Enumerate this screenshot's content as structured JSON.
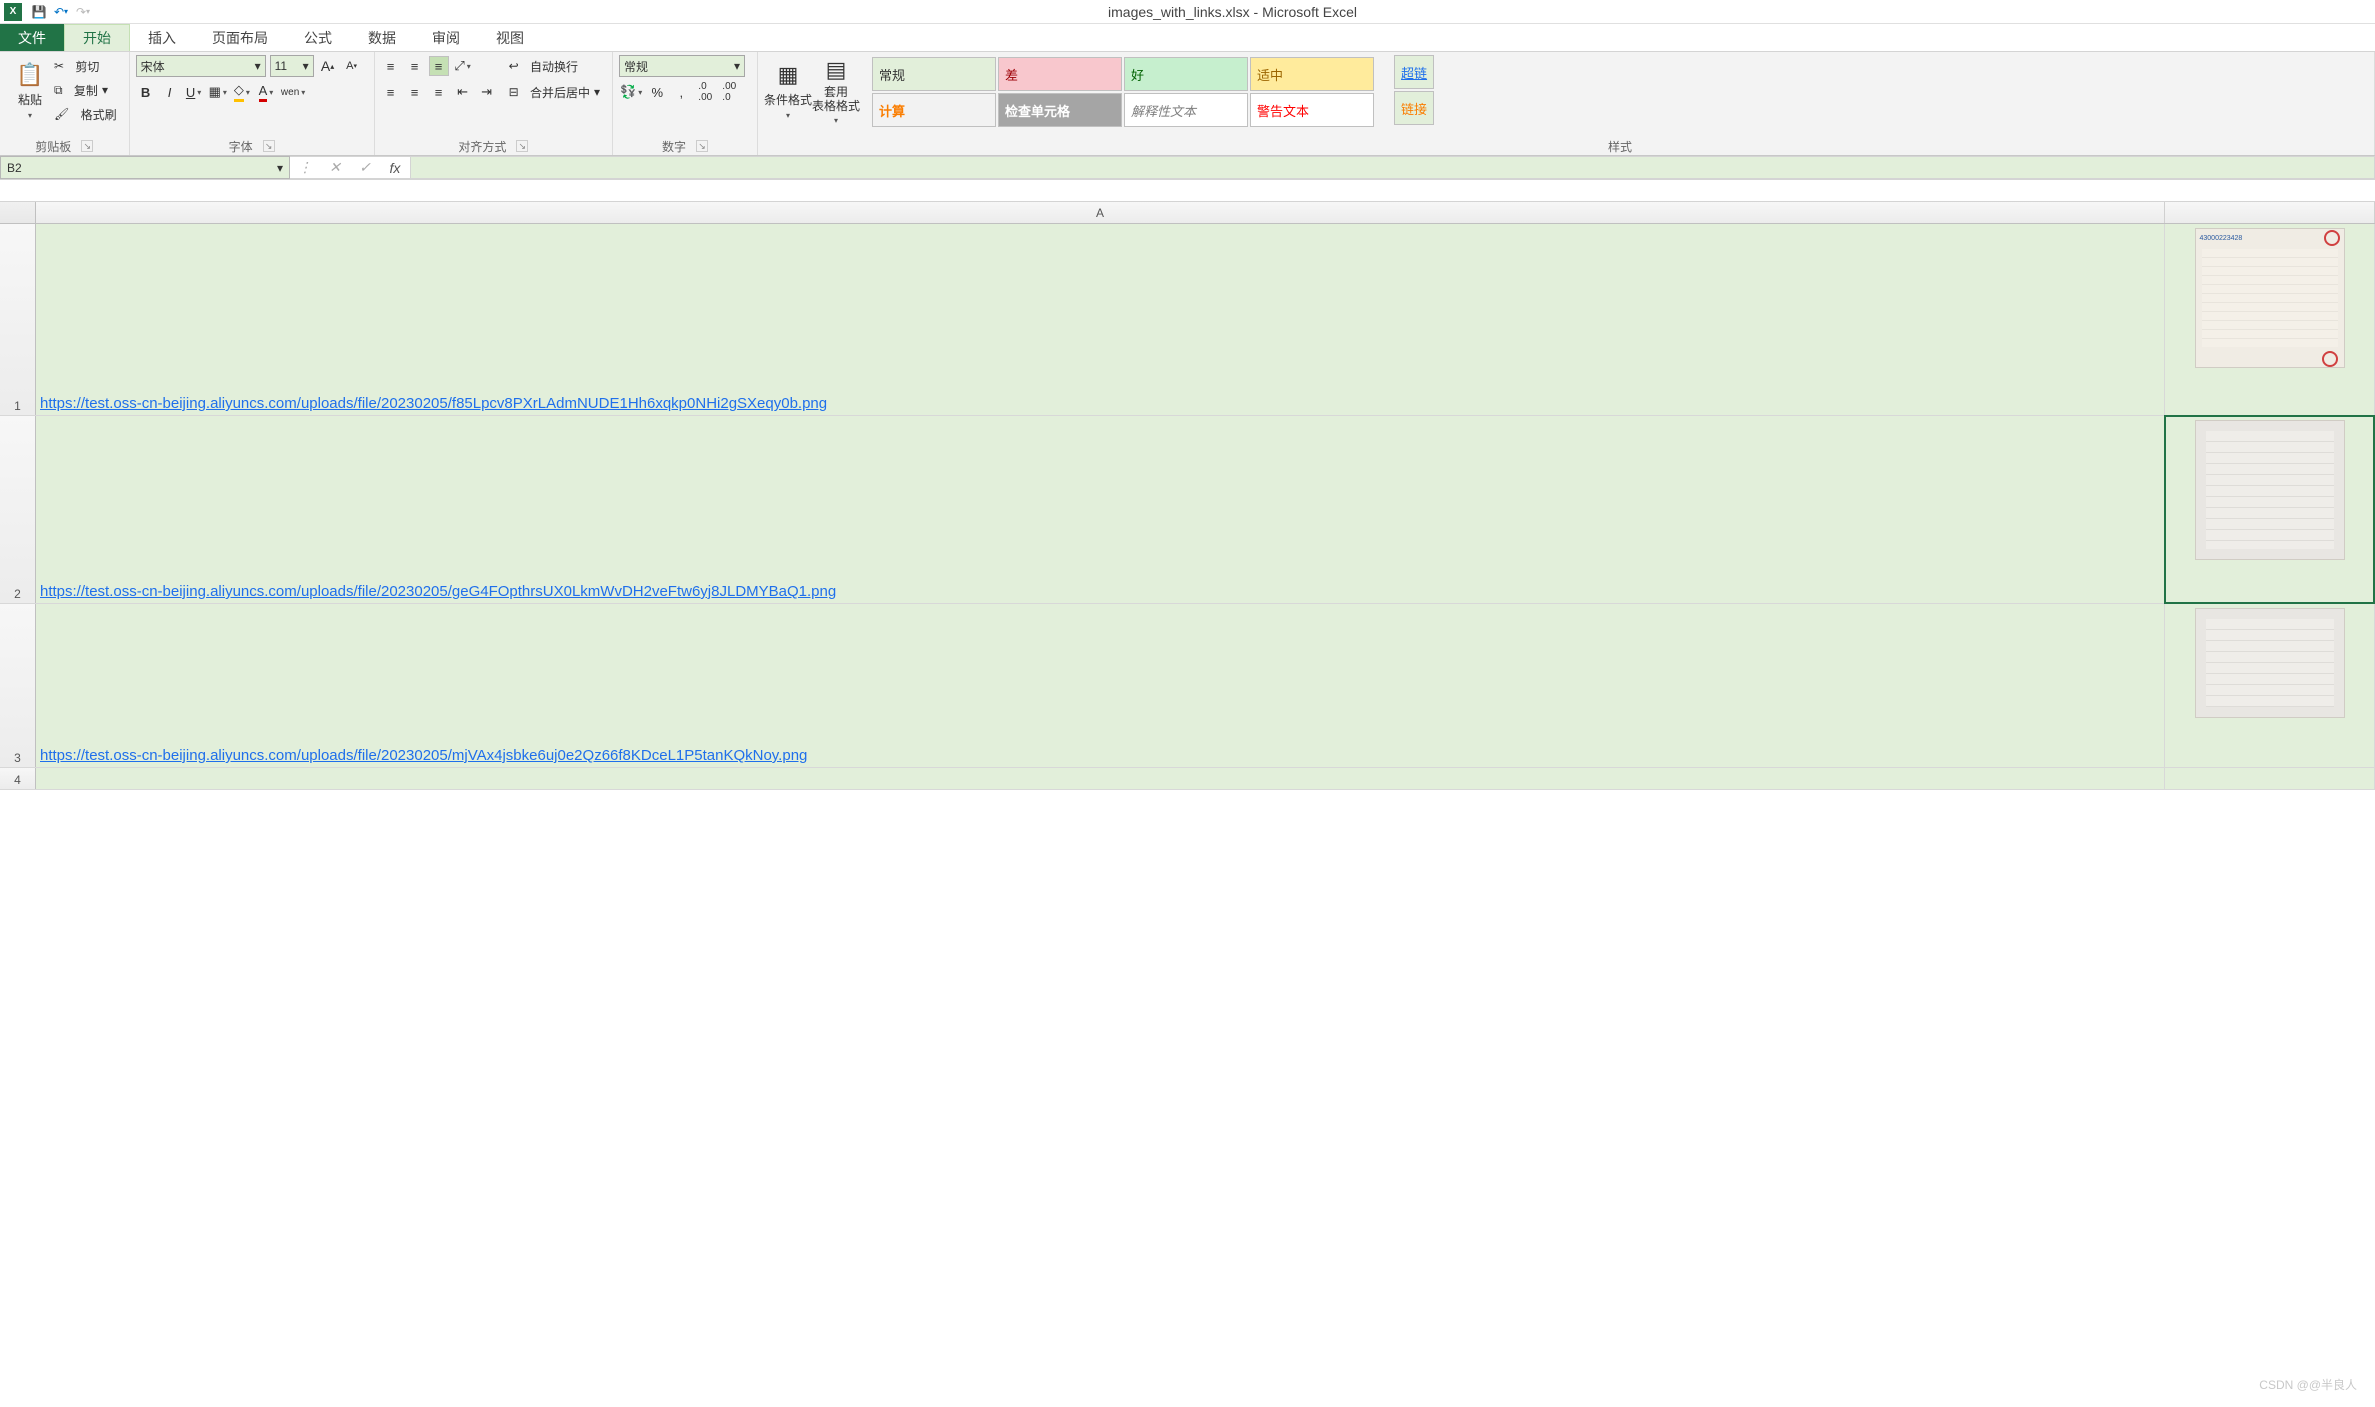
{
  "qat": {
    "app_initial": "X",
    "title": "images_with_links.xlsx - Microsoft Excel"
  },
  "tabs": {
    "file": "文件",
    "home": "开始",
    "insert": "插入",
    "pageLayout": "页面布局",
    "formulas": "公式",
    "data": "数据",
    "review": "审阅",
    "view": "视图"
  },
  "ribbon": {
    "clipboard": {
      "paste": "粘贴",
      "cut": "剪切",
      "copy": "复制",
      "formatPainter": "格式刷",
      "label": "剪贴板"
    },
    "font": {
      "name": "宋体",
      "size": "11",
      "label": "字体",
      "wen": "wen"
    },
    "align": {
      "wrap": "自动换行",
      "merge": "合并后居中",
      "label": "对齐方式"
    },
    "number": {
      "format": "常规",
      "label": "数字"
    },
    "cond": {
      "condFmt": "条件格式",
      "tableFmt": "套用\n表格格式"
    },
    "styles": {
      "label": "样式",
      "normal": "常规",
      "bad": "差",
      "good": "好",
      "neutral": "适中",
      "calc": "计算",
      "check": "检查单元格",
      "explain": "解释性文本",
      "warn": "警告文本",
      "hyper": "超链",
      "link": "链接"
    }
  },
  "fx": {
    "nameBox": "B2",
    "fxLabel": "fx"
  },
  "grid": {
    "colA": "A",
    "rows": [
      {
        "n": "1",
        "link": "https://test.oss-cn-beijing.aliyuncs.com/uploads/file/20230205/f85Lpcv8PXrLAdmNUDE1Hh6xqkp0NHi2gSXeqy0b.png"
      },
      {
        "n": "2",
        "link": "https://test.oss-cn-beijing.aliyuncs.com/uploads/file/20230205/geG4FOpthrsUX0LkmWvDH2veFtw6yj8JLDMYBaQ1.png"
      },
      {
        "n": "3",
        "link": "https://test.oss-cn-beijing.aliyuncs.com/uploads/file/20230205/mjVAx4jsbke6uj0e2Qz66f8KDceL1P5tanKQkNoy.png"
      },
      {
        "n": "4",
        "link": ""
      }
    ]
  },
  "watermark": "CSDN @@半良人"
}
